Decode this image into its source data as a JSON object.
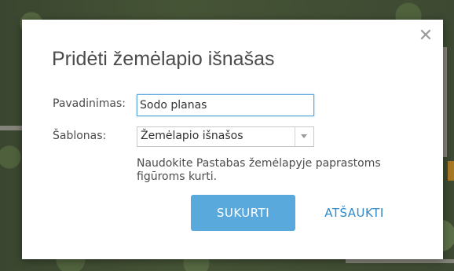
{
  "dialog": {
    "title": "Pridėti žemėlapio išnašas",
    "close_icon": "close-icon",
    "name_label": "Pavadinimas:",
    "name_value": "Sodo planas",
    "template_label": "Šablonas:",
    "template_value": "Žemėlapio išnašos",
    "hint": "Naudokite Pastabas žemėlapyje paprastoms figūroms kurti.",
    "create_label": "SUKURTI",
    "cancel_label": "ATŠAUKTI"
  },
  "colors": {
    "accent": "#5aa9dd",
    "link": "#2f8ac9",
    "text": "#4c4c4c"
  }
}
